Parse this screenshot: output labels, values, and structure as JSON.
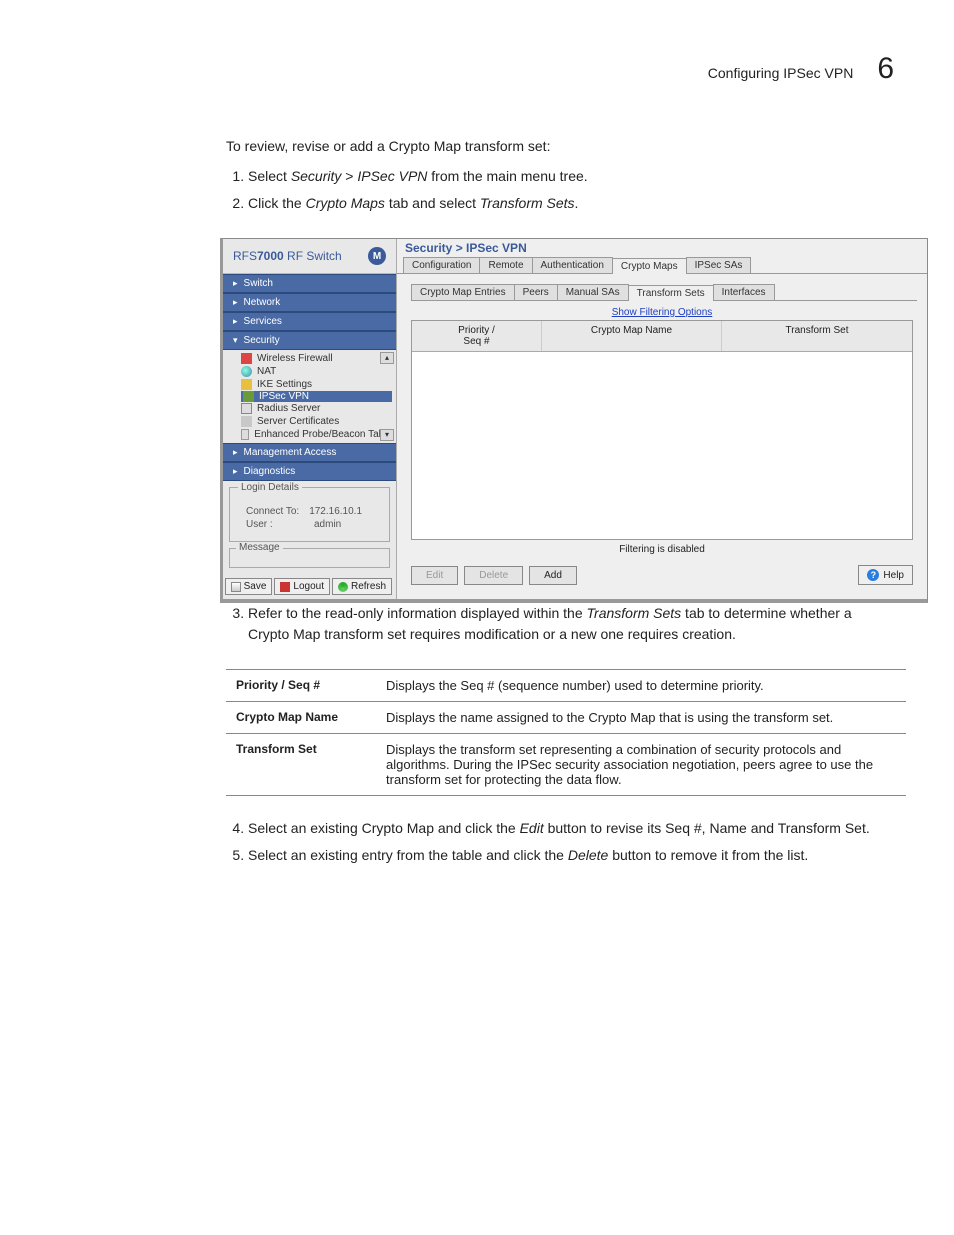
{
  "header": {
    "title": "Configuring IPSec VPN",
    "chapter": "6"
  },
  "intro": "To review, revise or add a Crypto Map transform set:",
  "step1": {
    "pre": "Select ",
    "i1": "Security",
    "mid": " > ",
    "i2": "IPSec VPN",
    "post": " from the main menu tree."
  },
  "step2": {
    "pre": "Click the ",
    "i1": "Crypto Maps",
    "mid": " tab and select ",
    "i2": "Transform Sets",
    "post": "."
  },
  "step3": {
    "pre": "Refer to the read-only information displayed within the ",
    "i1": "Transform Sets",
    "post": " tab to determine whether a Crypto Map transform set requires modification or a new one requires creation."
  },
  "step4": {
    "pre": "Select an existing Crypto Map and click the ",
    "i1": "Edit",
    "post": " button to revise its Seq #, Name and Transform Set."
  },
  "step5": {
    "pre": "Select an existing entry from the table and click the ",
    "i1": "Delete",
    "post": " button to remove it from the list."
  },
  "defs": [
    {
      "k": "Priority / Seq #",
      "v": "Displays the Seq # (sequence number) used to determine priority."
    },
    {
      "k": "Crypto Map Name",
      "v": "Displays the name assigned to the Crypto Map that is  using the transform set."
    },
    {
      "k": "Transform Set",
      "v": "Displays the transform set representing a combination of security protocols and algorithms. During the IPSec security association negotiation, peers agree to use the transform set for protecting the data flow."
    }
  ],
  "app": {
    "product_prefix": "RFS",
    "product_bold": "7000",
    "product_suffix": " RF Switch",
    "logo_letter": "M",
    "nav": {
      "switch": "Switch",
      "network": "Network",
      "services": "Services",
      "security": "Security",
      "mgmt": "Management Access",
      "diag": "Diagnostics"
    },
    "security_items": {
      "wfw": "Wireless Firewall",
      "nat": "NAT",
      "ike": "IKE Settings",
      "ipsec": "IPSec VPN",
      "radius": "Radius Server",
      "cert": "Server Certificates",
      "probe": "Enhanced Probe/Beacon Table"
    },
    "login": {
      "title": "Login Details",
      "connect_lbl": "Connect To:",
      "connect_val": "172.16.10.1",
      "user_lbl": "User :",
      "user_val": "admin"
    },
    "msg_title": "Message",
    "footer": {
      "save": "Save",
      "logout": "Logout",
      "refresh": "Refresh"
    },
    "crumb": "Security > IPSec VPN",
    "tabs1": [
      "Configuration",
      "Remote",
      "Authentication",
      "Crypto Maps",
      "IPSec SAs"
    ],
    "tabs1_active": 3,
    "tabs2": [
      "Crypto Map Entries",
      "Peers",
      "Manual SAs",
      "Transform Sets",
      "Interfaces"
    ],
    "tabs2_active": 3,
    "filter_link": "Show Filtering Options",
    "columns": {
      "c1a": "Priority /",
      "c1b": "Seq #",
      "c2": "Crypto Map Name",
      "c3": "Transform Set"
    },
    "filter_status": "Filtering is disabled",
    "buttons": {
      "edit": "Edit",
      "delete": "Delete",
      "add": "Add",
      "help": "Help"
    }
  }
}
